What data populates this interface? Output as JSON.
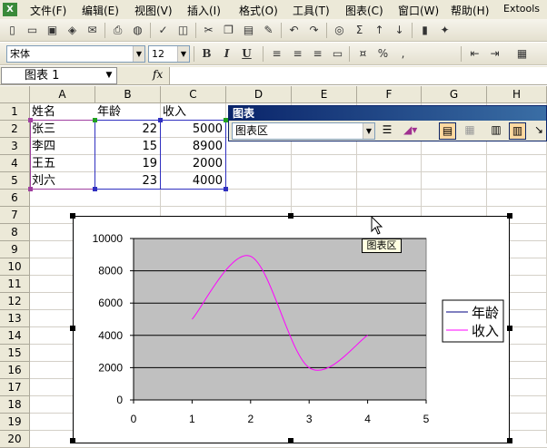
{
  "menu": [
    "文件(F)",
    "编辑(E)",
    "视图(V)",
    "插入(I)",
    "格式(O)",
    "工具(T)",
    "图表(C)",
    "窗口(W)",
    "帮助(H)",
    "Extools"
  ],
  "font_box": {
    "name": "宋体",
    "size": "12"
  },
  "format_buttons": {
    "bold": "B",
    "italic": "I",
    "underline": "U"
  },
  "namebox": {
    "value": "图表 1"
  },
  "fx_label": "fx",
  "columns": [
    "A",
    "B",
    "C",
    "D",
    "E",
    "F",
    "G",
    "H"
  ],
  "rows": [
    "1",
    "2",
    "3",
    "4",
    "5",
    "6",
    "7",
    "8",
    "9",
    "10",
    "11",
    "12",
    "13",
    "14",
    "15",
    "16",
    "17",
    "18",
    "19",
    "20"
  ],
  "table": {
    "headers": [
      "姓名",
      "年龄",
      "收入"
    ],
    "data": [
      [
        "张三",
        "22",
        "5000"
      ],
      [
        "李四",
        "15",
        "8900"
      ],
      [
        "王五",
        "19",
        "2000"
      ],
      [
        "刘六",
        "23",
        "4000"
      ]
    ]
  },
  "chart_toolbar": {
    "title": "图表",
    "area_select": "图表区"
  },
  "tooltip": "图表区",
  "chart_data": {
    "type": "scatter",
    "x_ticks": [
      "0",
      "1",
      "2",
      "3",
      "4",
      "5"
    ],
    "y_ticks": [
      "0",
      "2000",
      "4000",
      "6000",
      "8000",
      "10000"
    ],
    "xlim": [
      0,
      5
    ],
    "ylim": [
      0,
      10000
    ],
    "smooth": true,
    "plot_background": "#C0C0C0",
    "legend_position": "right",
    "series": [
      {
        "name": "年龄",
        "x": [],
        "y": [],
        "color": "#000080"
      },
      {
        "name": "收入",
        "x": [
          1,
          2,
          3,
          4
        ],
        "y": [
          5000,
          8900,
          2000,
          4000
        ],
        "color": "#FF00FF"
      }
    ]
  }
}
